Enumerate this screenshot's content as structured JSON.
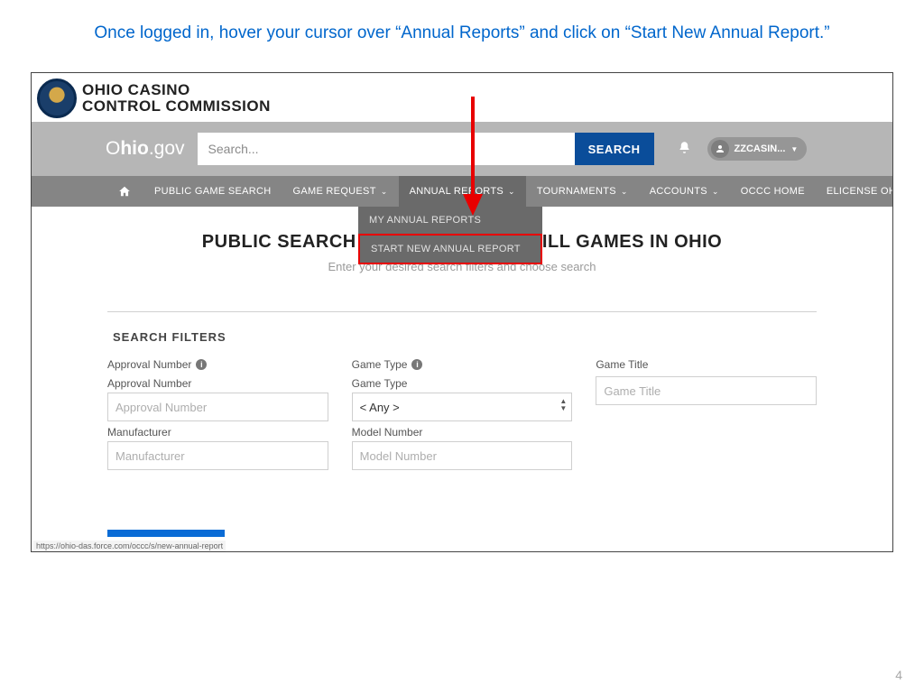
{
  "instruction": "Once logged in,  hover your cursor over “Annual Reports” and click on “Start New Annual Report.”",
  "logo": {
    "line1": "OHIO CASINO",
    "line2": "CONTROL COMMISSION"
  },
  "site_brand_light": "O",
  "site_brand_bold": "hio",
  "site_brand_rest": ".gov",
  "search": {
    "placeholder": "Search...",
    "button": "SEARCH"
  },
  "user": {
    "name": "ZZCASIN..."
  },
  "nav": {
    "public_game_search": "PUBLIC GAME SEARCH",
    "game_request": "GAME REQUEST",
    "annual_reports": "ANNUAL REPORTS",
    "tournaments": "TOURNAMENTS",
    "accounts": "ACCOUNTS",
    "occc_home": "OCCC HOME",
    "elicense": "ELICENSE OHIO"
  },
  "dropdown": {
    "my_reports": "MY ANNUAL REPORTS",
    "start_new": "START NEW ANNUAL REPORT"
  },
  "page": {
    "title": "PUBLIC SEARCH FOR APPROVED SKILL GAMES IN OHIO",
    "subtitle": "Enter your desired search filters and choose search"
  },
  "filters": {
    "title": "SEARCH FILTERS",
    "approval_label": "Approval Number",
    "approval_sublabel": "Approval Number",
    "approval_placeholder": "Approval Number",
    "manufacturer_label": "Manufacturer",
    "manufacturer_placeholder": "Manufacturer",
    "game_type_label": "Game Type",
    "game_type_sublabel": "Game Type",
    "game_type_value": "< Any >",
    "model_label": "Model Number",
    "model_placeholder": "Model Number",
    "game_title_label": "Game Title",
    "game_title_placeholder": "Game Title"
  },
  "status_url": "https://ohio-das.force.com/occc/s/new-annual-report",
  "page_number": "4"
}
